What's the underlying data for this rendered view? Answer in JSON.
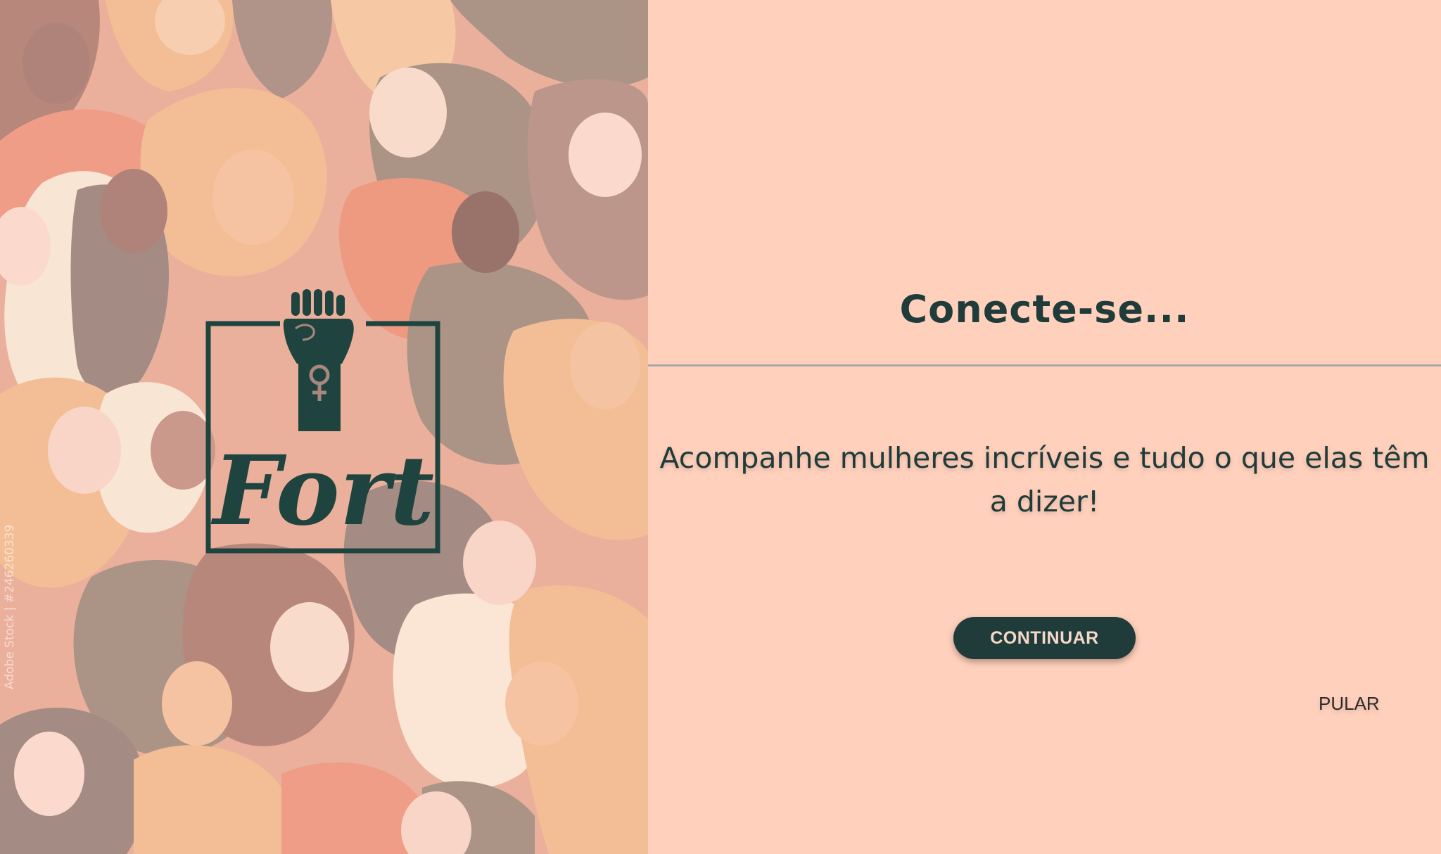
{
  "colors": {
    "background": "#ffd1bd",
    "primary": "#1f3c3a",
    "button_text": "#f6d8c8",
    "divider": "#a7a7a7"
  },
  "illustration": {
    "watermark": "Adobe Stock | #246260339",
    "logo_text": "Fort",
    "logo_icons": [
      "raised-fist-icon",
      "female-symbol-icon"
    ]
  },
  "onboarding": {
    "title": "Conecte-se...",
    "subtitle": "Acompanhe mulheres incríveis e tudo o que elas têm a dizer!",
    "continue_label": "CONTINUAR",
    "skip_label": "PULAR"
  }
}
